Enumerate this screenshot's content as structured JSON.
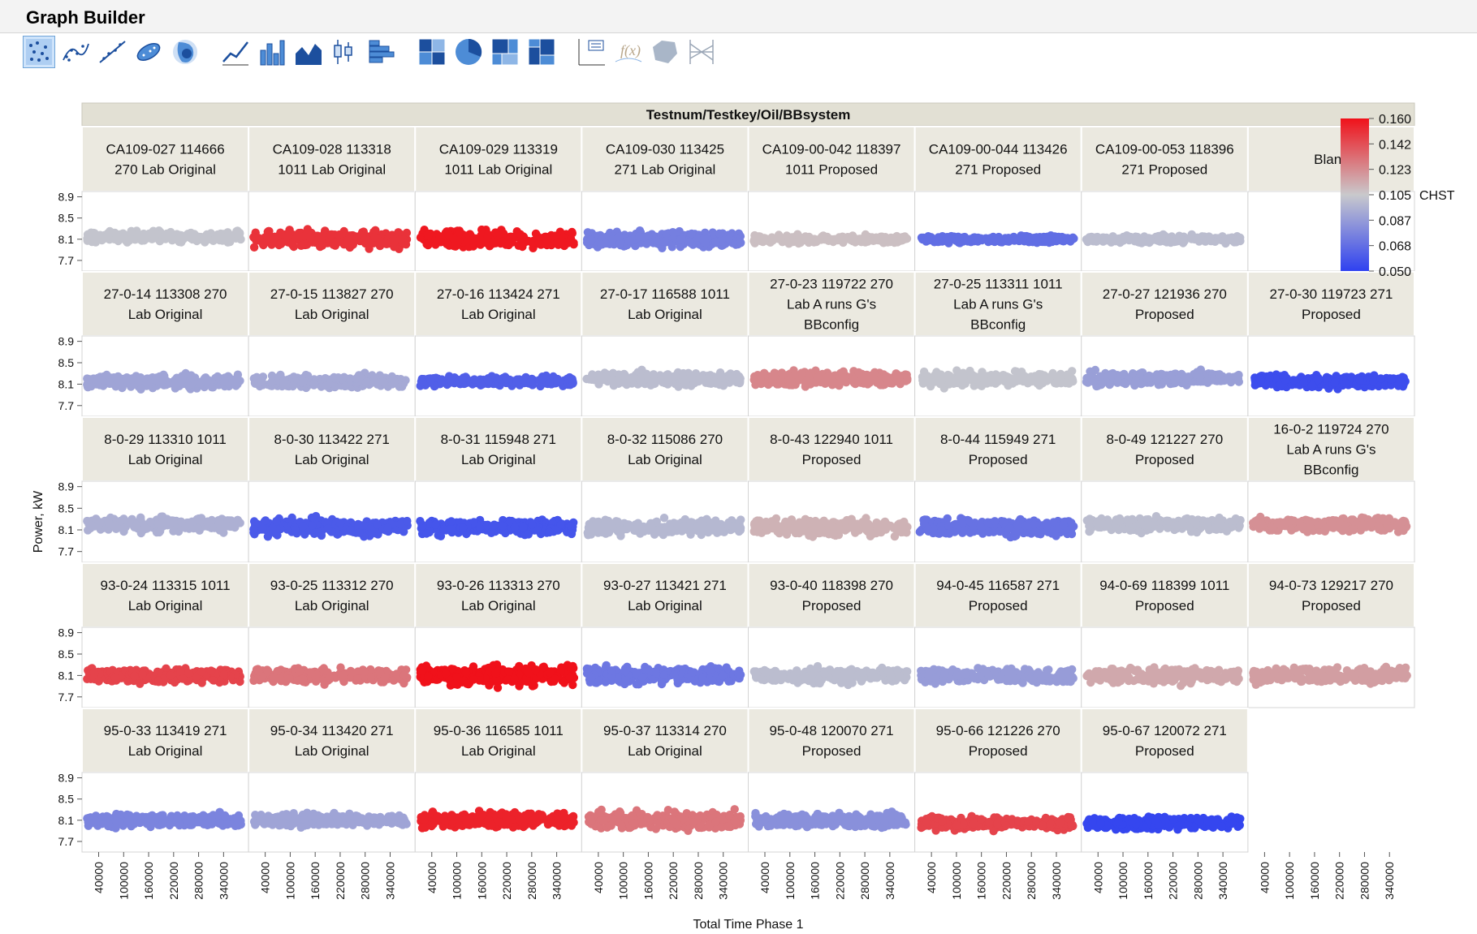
{
  "window": {
    "title": "Graph Builder"
  },
  "toolbar": {
    "buttons": [
      {
        "icon": "points-icon",
        "selected": true
      },
      {
        "icon": "smoother-icon",
        "selected": false
      },
      {
        "icon": "line-of-fit-icon",
        "selected": false
      },
      {
        "icon": "ellipse-icon",
        "selected": false
      },
      {
        "icon": "contour-icon",
        "selected": false
      },
      {
        "icon": "line-icon",
        "selected": false
      },
      {
        "icon": "bar-icon",
        "selected": false
      },
      {
        "icon": "area-icon",
        "selected": false
      },
      {
        "icon": "box-plot-icon",
        "selected": false
      },
      {
        "icon": "histogram-icon",
        "selected": false
      },
      {
        "icon": "heatmap-icon",
        "selected": false
      },
      {
        "icon": "pie-icon",
        "selected": false
      },
      {
        "icon": "treemap-icon",
        "selected": false
      },
      {
        "icon": "mosaic-icon",
        "selected": false
      },
      {
        "icon": "caption-box-icon",
        "selected": false
      },
      {
        "icon": "formula-icon",
        "selected": false
      },
      {
        "icon": "map-shapes-icon",
        "selected": false
      },
      {
        "icon": "parallel-plot-icon",
        "selected": false
      }
    ]
  },
  "chart_data": {
    "type": "scatter",
    "wrap_title": "Testnum/Testkey/Oil/BBsystem",
    "ylabel": "Power, kW",
    "xlabel": "Total Time Phase 1",
    "y_ticks": [
      "8.9",
      "8.5",
      "8.1",
      "7.7"
    ],
    "y_tick_values": [
      8.9,
      8.5,
      8.1,
      7.7
    ],
    "ylim": [
      7.5,
      9.0
    ],
    "x_ticks": [
      "40000",
      "100000",
      "160000",
      "220000",
      "280000",
      "340000"
    ],
    "x_tick_values": [
      40000,
      100000,
      160000,
      220000,
      280000,
      340000
    ],
    "xlim": [
      0,
      400000
    ],
    "grid": false,
    "legend": {
      "placement": "right",
      "variable": "CHST",
      "labels": [
        "0.160",
        "0.142",
        "0.123",
        "0.105",
        "0.087",
        "0.068",
        "0.050"
      ],
      "gradient": [
        "#f0111a",
        "#c9c9cc",
        "#2f41f0"
      ],
      "range": [
        0.05,
        0.16
      ]
    },
    "panels": [
      {
        "label": [
          "CA109-027 114666",
          "270 Lab Original"
        ],
        "chst": 0.103,
        "y_center": 8.15,
        "y_spread": 0.3
      },
      {
        "label": [
          "CA109-028 113318",
          "1011 Lab Original"
        ],
        "chst": 0.15,
        "y_center": 8.1,
        "y_spread": 0.45
      },
      {
        "label": [
          "CA109-029 113319",
          "1011 Lab Original"
        ],
        "chst": 0.158,
        "y_center": 8.1,
        "y_spread": 0.45
      },
      {
        "label": [
          "CA109-030 113425",
          "271 Lab Original"
        ],
        "chst": 0.075,
        "y_center": 8.1,
        "y_spread": 0.45
      },
      {
        "label": [
          "CA109-00-042 118397",
          "1011 Proposed"
        ],
        "chst": 0.108,
        "y_center": 8.1,
        "y_spread": 0.2
      },
      {
        "label": [
          "CA109-00-044 113426",
          "271 Proposed"
        ],
        "chst": 0.068,
        "y_center": 8.1,
        "y_spread": 0.18
      },
      {
        "label": [
          "CA109-00-053 118396",
          "271 Proposed"
        ],
        "chst": 0.1,
        "y_center": 8.1,
        "y_spread": 0.2
      },
      {
        "label": [
          "Blank"
        ],
        "chst": null,
        "y_center": null,
        "y_spread": null
      },
      {
        "label": [
          "27-0-14 113308 270",
          "Lab Original"
        ],
        "chst": 0.09,
        "y_center": 8.15,
        "y_spread": 0.35
      },
      {
        "label": [
          "27-0-15 113827 270",
          "Lab Original"
        ],
        "chst": 0.092,
        "y_center": 8.15,
        "y_spread": 0.35
      },
      {
        "label": [
          "27-0-16 113424 271",
          "Lab Original"
        ],
        "chst": 0.062,
        "y_center": 8.15,
        "y_spread": 0.25
      },
      {
        "label": [
          "27-0-17 116588 1011",
          "Lab Original"
        ],
        "chst": 0.1,
        "y_center": 8.2,
        "y_spread": 0.35
      },
      {
        "label": [
          "27-0-23 119722 270",
          "Lab A runs G's",
          "BBconfig"
        ],
        "chst": 0.125,
        "y_center": 8.2,
        "y_spread": 0.4
      },
      {
        "label": [
          "27-0-25 113311 1011",
          "Lab A runs G's",
          "BBconfig"
        ],
        "chst": 0.103,
        "y_center": 8.2,
        "y_spread": 0.4
      },
      {
        "label": [
          "27-0-27 121936 270",
          "Proposed"
        ],
        "chst": 0.088,
        "y_center": 8.2,
        "y_spread": 0.35
      },
      {
        "label": [
          "27-0-30 119723 271",
          "Proposed"
        ],
        "chst": 0.055,
        "y_center": 8.15,
        "y_spread": 0.35
      },
      {
        "label": [
          "8-0-29 113310 1011",
          "Lab Original"
        ],
        "chst": 0.095,
        "y_center": 8.2,
        "y_spread": 0.4
      },
      {
        "label": [
          "8-0-30 113422 271",
          "Lab Original"
        ],
        "chst": 0.06,
        "y_center": 8.15,
        "y_spread": 0.45
      },
      {
        "label": [
          "8-0-31 115948 271",
          "Lab Original"
        ],
        "chst": 0.058,
        "y_center": 8.15,
        "y_spread": 0.4
      },
      {
        "label": [
          "8-0-32 115086 270",
          "Lab Original"
        ],
        "chst": 0.098,
        "y_center": 8.15,
        "y_spread": 0.4
      },
      {
        "label": [
          "8-0-43 122940 1011",
          "Proposed"
        ],
        "chst": 0.112,
        "y_center": 8.15,
        "y_spread": 0.45
      },
      {
        "label": [
          "8-0-44 115949 271",
          "Proposed"
        ],
        "chst": 0.07,
        "y_center": 8.15,
        "y_spread": 0.45
      },
      {
        "label": [
          "8-0-49 121227 270",
          "Proposed"
        ],
        "chst": 0.1,
        "y_center": 8.2,
        "y_spread": 0.35
      },
      {
        "label": [
          "16-0-2 119724 270",
          "Lab A runs G's",
          "BBconfig"
        ],
        "chst": 0.122,
        "y_center": 8.2,
        "y_spread": 0.4
      },
      {
        "label": [
          "93-0-24 113315 1011",
          "Lab Original"
        ],
        "chst": 0.145,
        "y_center": 8.1,
        "y_spread": 0.4
      },
      {
        "label": [
          "93-0-25 113312 270",
          "Lab Original"
        ],
        "chst": 0.13,
        "y_center": 8.1,
        "y_spread": 0.4
      },
      {
        "label": [
          "93-0-26 113313 270",
          "Lab Original"
        ],
        "chst": 0.16,
        "y_center": 8.1,
        "y_spread": 0.55
      },
      {
        "label": [
          "93-0-27 113421 271",
          "Lab Original"
        ],
        "chst": 0.072,
        "y_center": 8.1,
        "y_spread": 0.45
      },
      {
        "label": [
          "93-0-40 118398 270",
          "Proposed"
        ],
        "chst": 0.1,
        "y_center": 8.1,
        "y_spread": 0.4
      },
      {
        "label": [
          "94-0-45 116587 271",
          "Proposed"
        ],
        "chst": 0.087,
        "y_center": 8.1,
        "y_spread": 0.4
      },
      {
        "label": [
          "94-0-69 118399 1011",
          "Proposed"
        ],
        "chst": 0.115,
        "y_center": 8.1,
        "y_spread": 0.4
      },
      {
        "label": [
          "94-0-73 129217 270",
          "Proposed"
        ],
        "chst": 0.118,
        "y_center": 8.1,
        "y_spread": 0.4
      },
      {
        "label": [
          "95-0-33 113419 271",
          "Lab Original"
        ],
        "chst": 0.077,
        "y_center": 8.1,
        "y_spread": 0.35
      },
      {
        "label": [
          "95-0-34 113420 271",
          "Lab Original"
        ],
        "chst": 0.09,
        "y_center": 8.1,
        "y_spread": 0.35
      },
      {
        "label": [
          "95-0-36 116585 1011",
          "Lab Original"
        ],
        "chst": 0.155,
        "y_center": 8.1,
        "y_spread": 0.4
      },
      {
        "label": [
          "95-0-37 113314 270",
          "Lab Original"
        ],
        "chst": 0.13,
        "y_center": 8.1,
        "y_spread": 0.45
      },
      {
        "label": [
          "95-0-48 120070 271",
          "Proposed"
        ],
        "chst": 0.082,
        "y_center": 8.1,
        "y_spread": 0.4
      },
      {
        "label": [
          "95-0-66 121226 270",
          "Proposed"
        ],
        "chst": 0.145,
        "y_center": 8.05,
        "y_spread": 0.35
      },
      {
        "label": [
          "95-0-67 120072 271",
          "Proposed"
        ],
        "chst": 0.052,
        "y_center": 8.05,
        "y_spread": 0.35
      }
    ]
  }
}
